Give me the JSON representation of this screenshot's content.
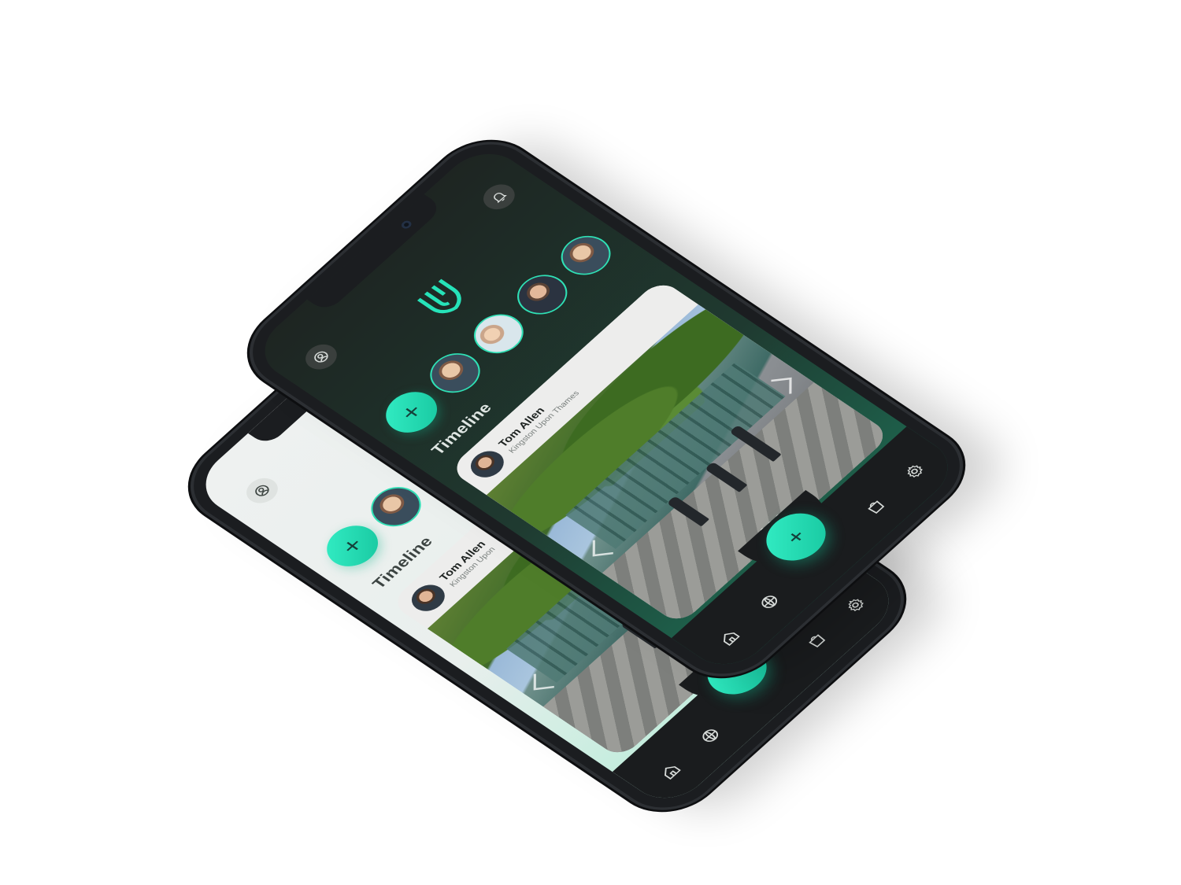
{
  "app": {
    "accent_color": "#26e3b9",
    "dark_theme_color": "#1f3a30",
    "light_theme_color": "#eef1f0"
  },
  "timeline": {
    "title": "Timeline"
  },
  "post": {
    "author_name": "Tom Allen",
    "author_location": "Kingston Upon Thames",
    "back_author_location": "Kingston Upon"
  },
  "icons": {
    "profile": "profile-icon",
    "notifications": "bell-icon",
    "add_story": "plus-icon",
    "home": "home-icon",
    "explore": "globe-icon",
    "create": "plus-icon",
    "shop": "bag-icon",
    "settings": "gear-icon"
  }
}
